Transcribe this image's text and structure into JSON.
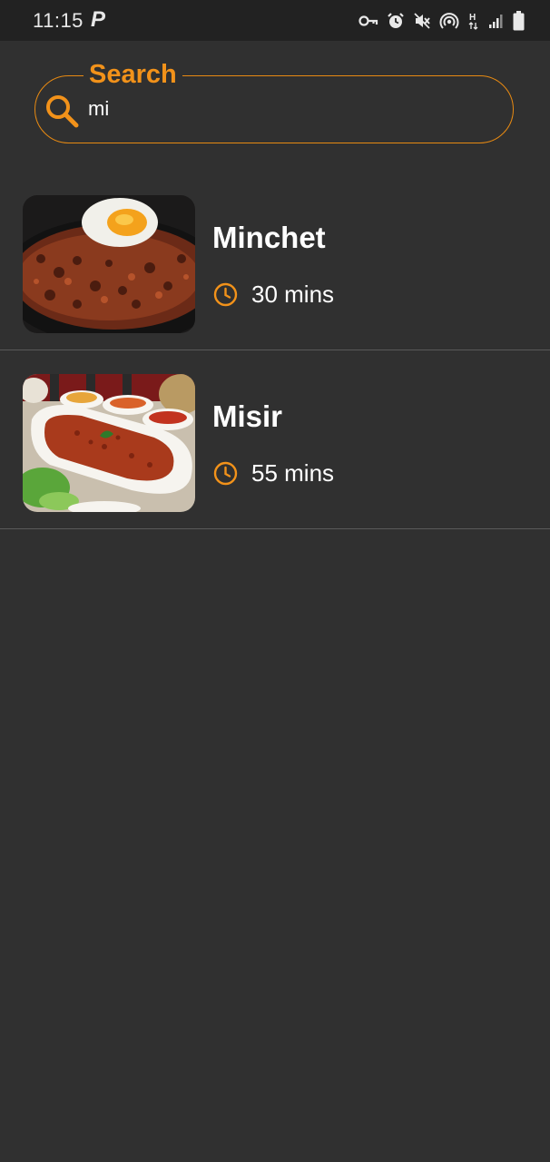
{
  "status_bar": {
    "time": "11:15",
    "app_indicator": "P",
    "icons": [
      "vpn-key-icon",
      "alarm-icon",
      "mute-icon",
      "hotspot-icon",
      "h-plus-data-icon",
      "signal-icon",
      "battery-icon"
    ],
    "data_type": "H"
  },
  "search": {
    "label": "Search",
    "value": "mi",
    "icon": "search-icon"
  },
  "recipes": [
    {
      "name": "Minchet",
      "time": "30 mins",
      "image": "minchet-dish-image",
      "time_icon": "clock-icon"
    },
    {
      "name": "Misir",
      "time": "55 mins",
      "image": "misir-dish-image",
      "time_icon": "clock-icon"
    }
  ],
  "colors": {
    "background": "#303030",
    "status_bar": "#222222",
    "accent": "#f2921a",
    "text": "#ffffff",
    "divider": "#5a5a5a"
  }
}
